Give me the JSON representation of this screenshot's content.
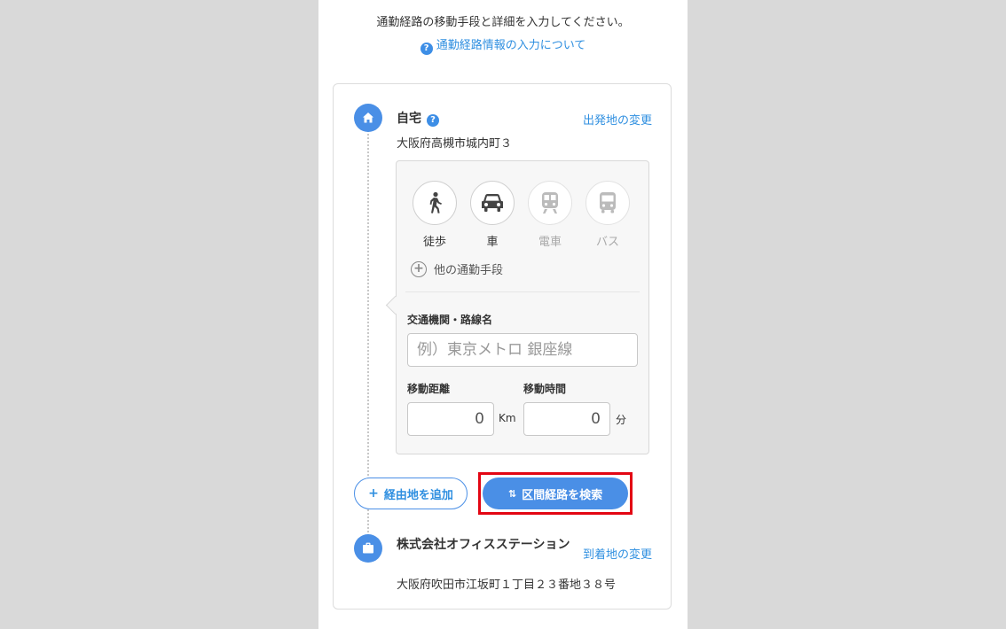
{
  "intro": {
    "text": "通勤経路の移動手段と詳細を入力してください。",
    "help_link": "通勤経路情報の入力について",
    "help_icon_glyph": "?"
  },
  "origin": {
    "title": "自宅",
    "help_glyph": "?",
    "address": "大阪府高槻市城内町３",
    "change_link": "出発地の変更",
    "icon": "home-icon"
  },
  "modes": [
    {
      "label": "徒歩",
      "icon": "walk-icon",
      "enabled": true
    },
    {
      "label": "車",
      "icon": "car-icon",
      "enabled": true
    },
    {
      "label": "電車",
      "icon": "train-icon",
      "enabled": false
    },
    {
      "label": "バス",
      "icon": "bus-icon",
      "enabled": false
    }
  ],
  "other_modes": {
    "label": "他の通勤手段",
    "glyph": "+"
  },
  "route": {
    "label": "交通機関・路線名",
    "placeholder": "例）東京メトロ 銀座線",
    "value": ""
  },
  "distance": {
    "label": "移動距離",
    "value": "0",
    "unit": "Km"
  },
  "duration": {
    "label": "移動時間",
    "value": "0",
    "unit": "分"
  },
  "actions": {
    "via_label": "経由地を追加",
    "via_glyph": "+",
    "search_label": "区間経路を検索",
    "search_glyph": "⇅"
  },
  "destination": {
    "title": "株式会社オフィスステーション",
    "address": "大阪府吹田市江坂町１丁目２３番地３８号",
    "change_link": "到着地の変更",
    "icon": "briefcase-icon"
  },
  "colors": {
    "accent": "#4a8fe6",
    "link": "#2f8fe0",
    "highlight": "#e30613",
    "background": "#d9d9d9"
  }
}
